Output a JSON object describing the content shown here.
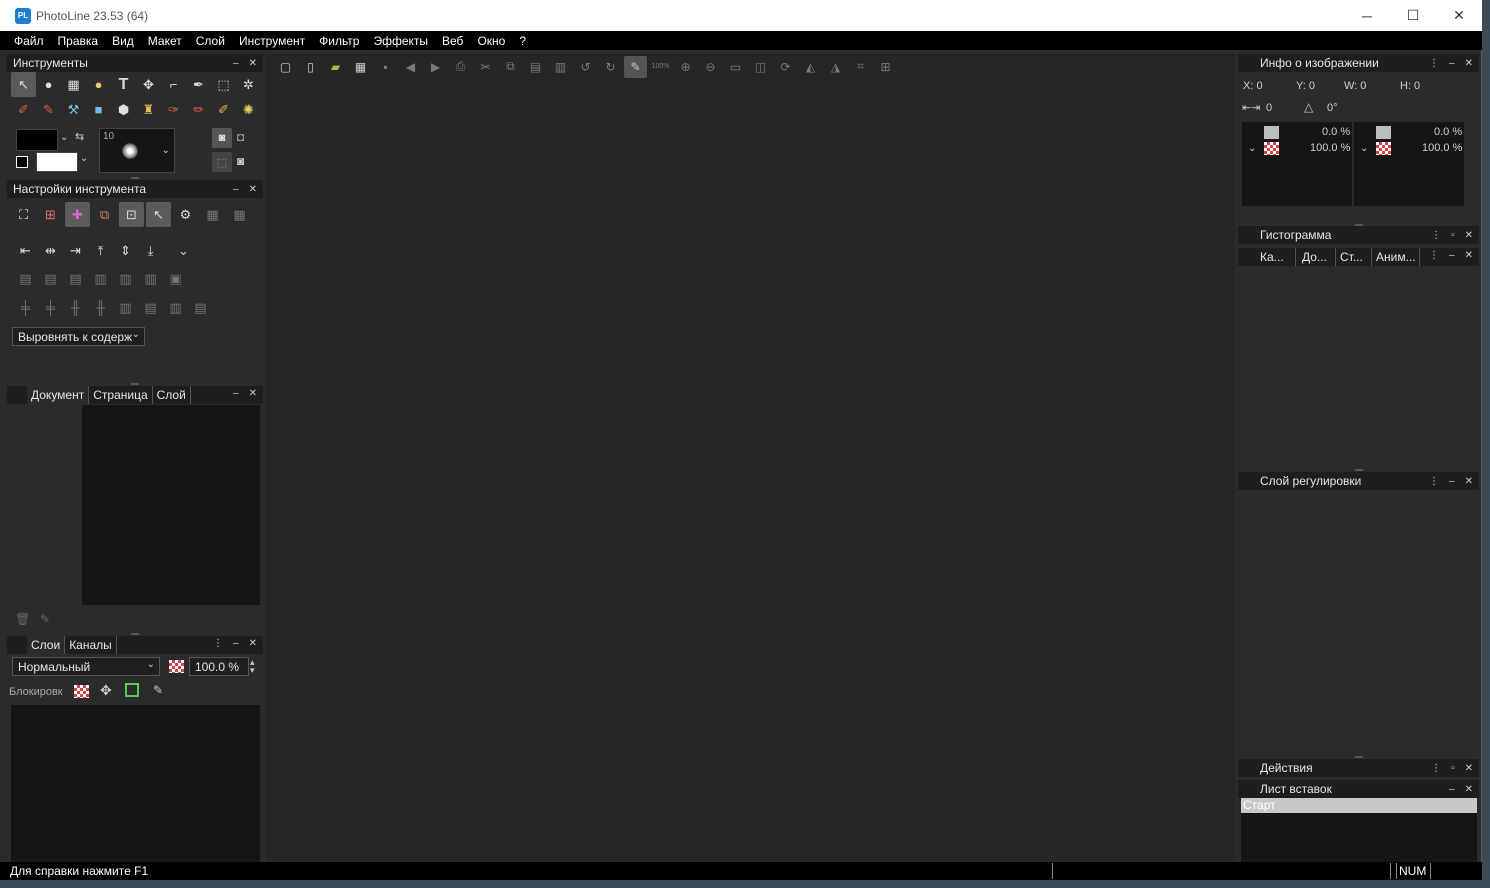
{
  "window": {
    "title": "PhotoLine 23.53 (64)",
    "logo_text": "PL"
  },
  "menu": [
    "Файл",
    "Правка",
    "Вид",
    "Макет",
    "Слой",
    "Инструмент",
    "Фильтр",
    "Эффекты",
    "Веб",
    "Окно",
    "?"
  ],
  "left": {
    "tools_panel": {
      "title": "Инструменты",
      "brush_size": "10"
    },
    "tool_settings": {
      "title": "Настройки инструмента",
      "align_dropdown": "Выровнять к содерж"
    },
    "doc_panel": {
      "tabs": [
        "Документ",
        "Страница",
        "Слой"
      ]
    },
    "layers_panel": {
      "tabs": [
        "Слои",
        "Каналы"
      ],
      "blend_mode": "Нормальный",
      "opacity": "100.0 %",
      "lock_label": "Блокировк"
    }
  },
  "right": {
    "image_info": {
      "title": "Инфо о изображении",
      "x": "X: 0",
      "y": "Y: 0",
      "w": "W: 0",
      "h": "H: 0",
      "dist": "0",
      "angle": "0°",
      "left_top_pct": "0.0 %",
      "left_bottom_pct": "100.0 %",
      "right_top_pct": "0.0 %",
      "right_bottom_pct": "100.0 %"
    },
    "histogram": {
      "title": "Гистограмма",
      "tabs": [
        "Ка...",
        "До...",
        "Ст...",
        "Аним..."
      ]
    },
    "adjustment": {
      "title": "Слой регулировки"
    },
    "actions": {
      "title": "Действия"
    },
    "clipboard": {
      "title": "Лист вставок",
      "items": [
        "Старт"
      ]
    }
  },
  "status": {
    "help": "Для справки нажмите F1",
    "num": "NUM"
  },
  "colors": {
    "accent": "#1e7fd0",
    "bg": "#2b2b2b",
    "canvas": "#262626"
  }
}
